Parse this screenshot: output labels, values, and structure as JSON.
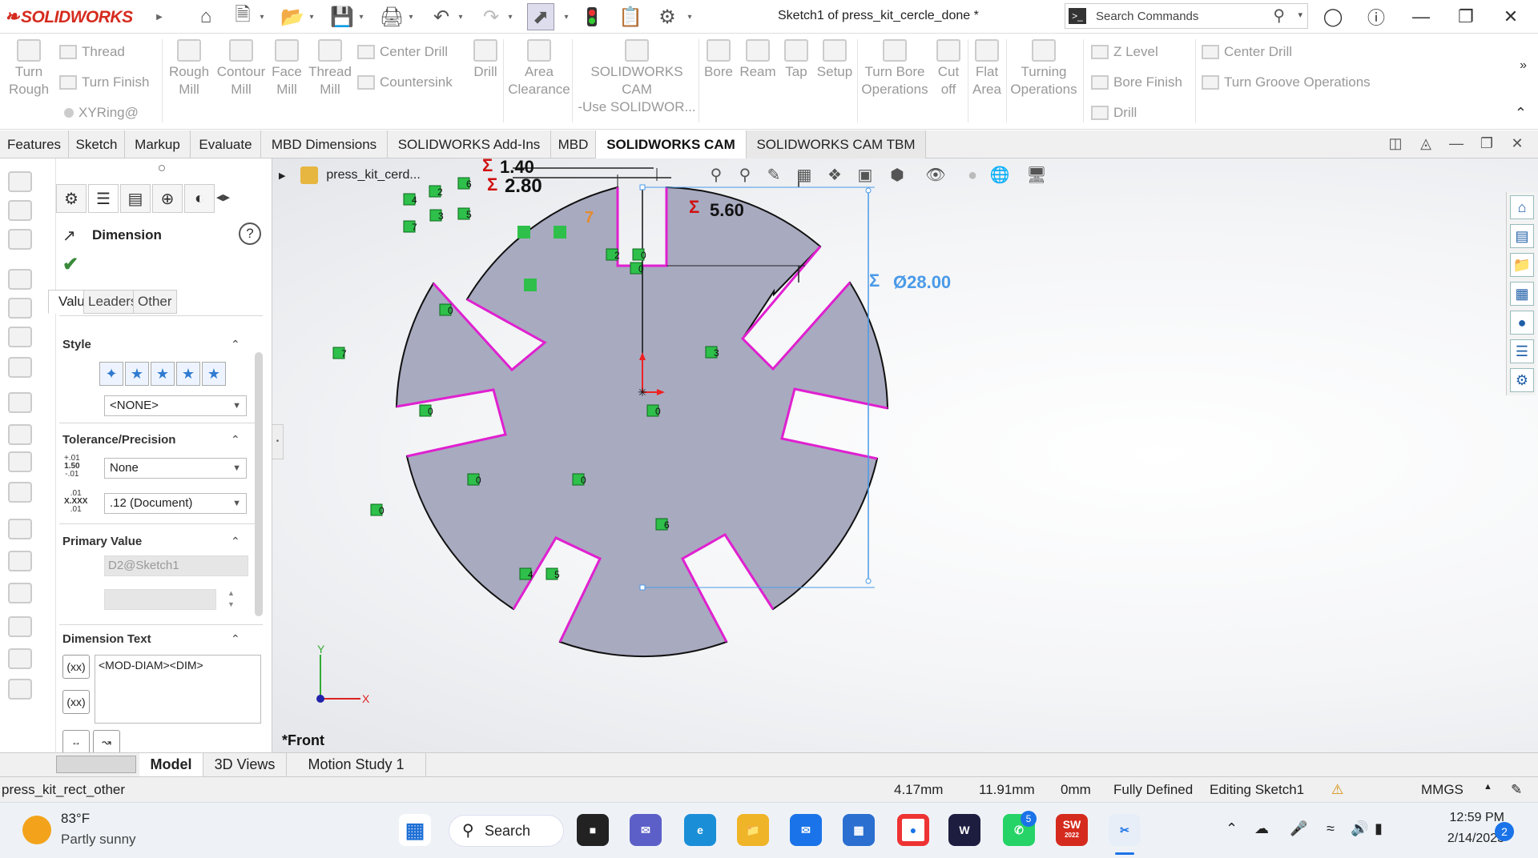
{
  "app": {
    "brand": "SOLIDWORKS",
    "window_title": "Sketch1 of press_kit_cercle_done *"
  },
  "search": {
    "placeholder": "Search Commands"
  },
  "ribbon": {
    "thread": "Thread",
    "turn_finish": "Turn Finish",
    "xyring": "XYRing@",
    "turn_rough": [
      "Turn",
      "Rough"
    ],
    "rough_mill": [
      "Rough",
      "Mill"
    ],
    "contour_mill": [
      "Contour",
      "Mill"
    ],
    "face_mill": [
      "Face",
      "Mill"
    ],
    "thread_mill": [
      "Thread",
      "Mill"
    ],
    "center_drill": "Center Drill",
    "countersink": "Countersink",
    "drill": "Drill",
    "area_clearance": [
      "Area",
      "Clearance"
    ],
    "sw_cam": [
      "SOLIDWORKS CAM",
      "-Use SOLIDWOR..."
    ],
    "bore": "Bore",
    "ream": "Ream",
    "tap": "Tap",
    "setup": "Setup",
    "turn_bore_ops": [
      "Turn Bore",
      "Operations"
    ],
    "cut_off": [
      "Cut",
      "off"
    ],
    "flat_area": [
      "Flat",
      "Area"
    ],
    "turning_ops": [
      "Turning",
      "Operations"
    ],
    "z_level": "Z Level",
    "bore_finish": "Bore Finish",
    "drill2": "Drill",
    "center_drill2": "Center Drill",
    "turn_groove": "Turn Groove Operations"
  },
  "tabs": [
    "Features",
    "Sketch",
    "Markup",
    "Evaluate",
    "MBD Dimensions",
    "SOLIDWORKS Add-Ins",
    "MBD",
    "SOLIDWORKS CAM",
    "SOLIDWORKS CAM TBM"
  ],
  "active_tab": "SOLIDWORKS CAM",
  "tree": {
    "part_name": "press_kit_cerd..."
  },
  "pm": {
    "title": "Dimension",
    "subtabs": [
      "Value",
      "Leaders",
      "Other"
    ],
    "style": {
      "label": "Style",
      "value": "<NONE>"
    },
    "tolerance": {
      "label": "Tolerance/Precision",
      "tol_type": "None",
      "precision": ".12 (Document)",
      "icon1": [
        "+.01",
        "1.50",
        "-.01"
      ],
      "icon2": [
        ".01",
        "X.XXX",
        ".01"
      ]
    },
    "primary": {
      "label": "Primary Value",
      "name": "D2@Sketch1"
    },
    "dimtext": {
      "label": "Dimension Text",
      "text": "<MOD-DIAM><DIM>",
      "btn1": "(xx)",
      "btn2": "(xx)"
    }
  },
  "sketch": {
    "dim_140": "1.40",
    "dim_280": "2.80",
    "dim_560": "5.60",
    "dim_diam": "Ø28.00",
    "sigma": "Σ",
    "orange": "7",
    "relations": [
      "6",
      "2",
      "4",
      "3",
      "5",
      "7",
      "2",
      "0",
      "0",
      "0",
      "3",
      "7",
      "0",
      "0",
      "0",
      "0",
      "0",
      "6",
      "4",
      "5"
    ],
    "view_label": "*Front",
    "axis_x": "X",
    "axis_y": "Y"
  },
  "bottom_tabs": [
    "Model",
    "3D Views",
    "Motion Study 1"
  ],
  "status": {
    "doc": "press_kit_rect_other",
    "x": "4.17mm",
    "y": "11.91mm",
    "z": "0mm",
    "state": "Fully Defined",
    "mode": "Editing Sketch1",
    "units": "MMGS"
  },
  "taskbar": {
    "temp": "83°F",
    "weather": "Partly sunny",
    "search": "Search",
    "whatsapp_badge": "5",
    "sw_label": "SW",
    "sw_year": "2022",
    "time": "12:59 PM",
    "date": "2/14/2023",
    "notif": "2"
  },
  "colors": {
    "profile": "#e020d0",
    "sketch_fill": "#a8aac0",
    "dim_blue": "#4a9ae8",
    "sigma_red": "#d01010",
    "relation_green": "#2ec04a",
    "accent": "#d52b1e"
  }
}
